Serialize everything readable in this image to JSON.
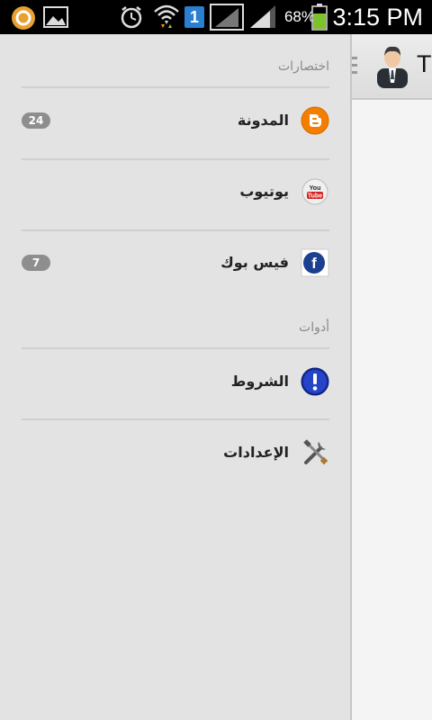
{
  "status_bar": {
    "battery_percent": "68%",
    "time": "3:15 PM",
    "sim_slot": "1"
  },
  "app_bar": {
    "title": "T"
  },
  "drawer": {
    "sections": [
      {
        "header": "اختصارات",
        "items": [
          {
            "label": "المدونة",
            "counter": "24",
            "icon": "blogger-icon"
          },
          {
            "label": "يوتيوب",
            "counter": null,
            "icon": "youtube-icon"
          },
          {
            "label": "فيس بوك",
            "counter": "7",
            "icon": "facebook-icon"
          }
        ]
      },
      {
        "header": "أدوات",
        "items": [
          {
            "label": "الشروط",
            "counter": null,
            "icon": "info-exclamation-icon"
          },
          {
            "label": "الإعدادات",
            "counter": null,
            "icon": "tools-icon"
          }
        ]
      }
    ]
  },
  "colors": {
    "drawer_background": "#e3e3e3",
    "counter_badge": "#8e8e8e",
    "blogger_orange": "#f57d00",
    "facebook_blue": "#1c3f8f"
  }
}
